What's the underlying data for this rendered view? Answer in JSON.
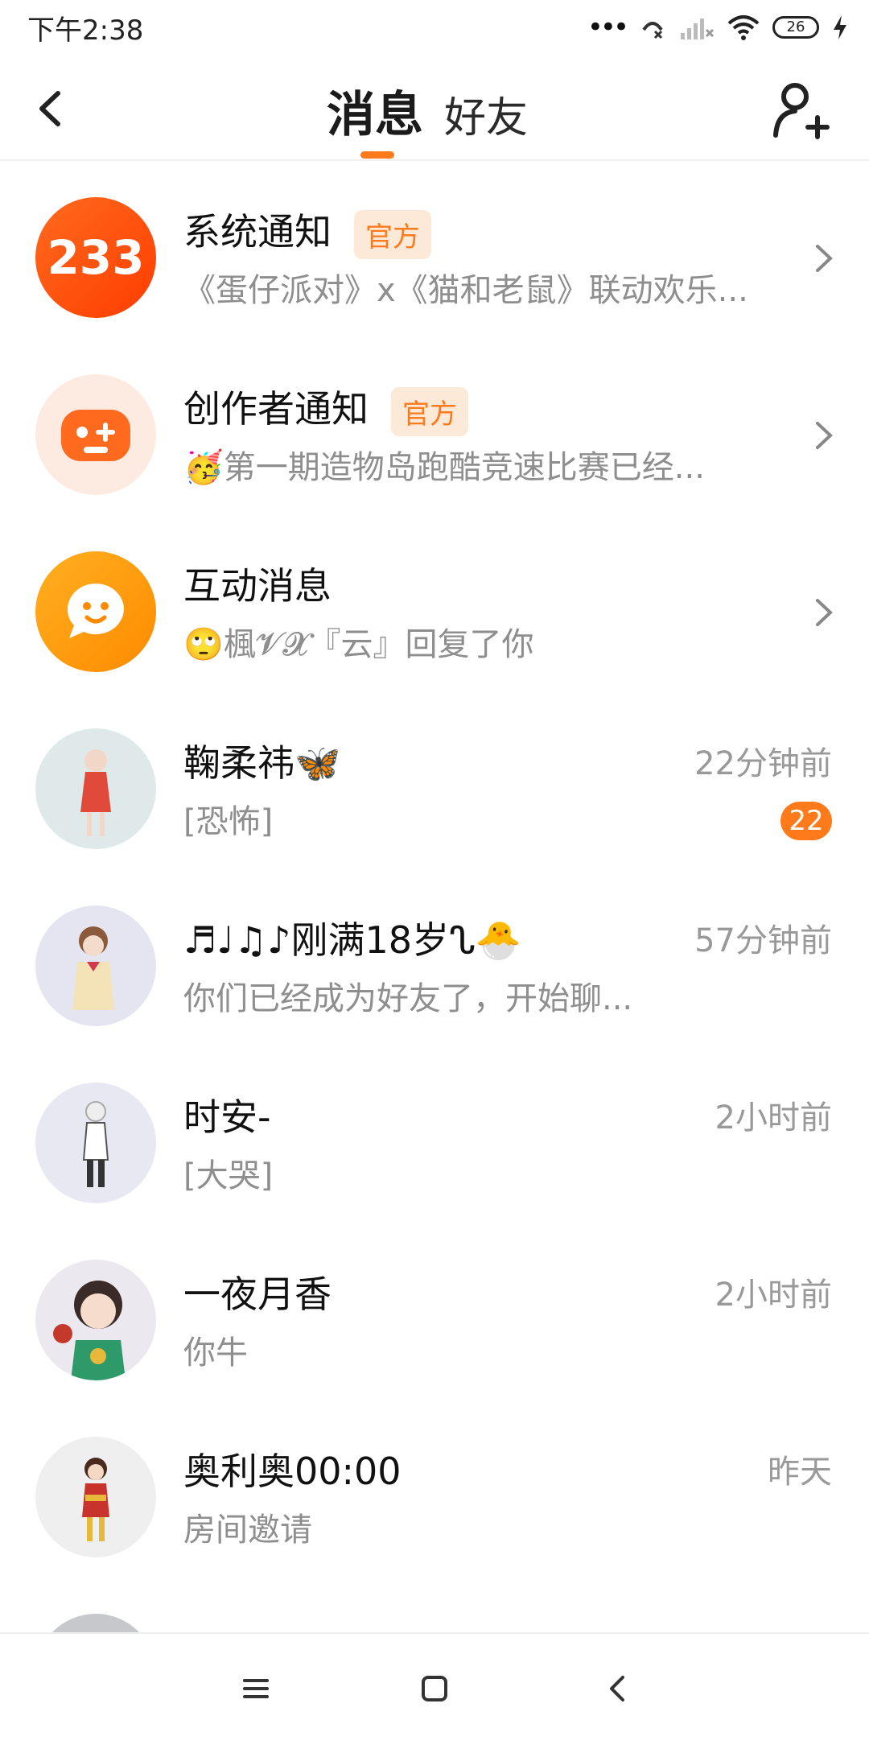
{
  "status_bar": {
    "time": "下午2:38",
    "battery": "26",
    "icons": [
      "more-dots-icon",
      "no-call-icon",
      "no-signal-icon",
      "wifi-icon",
      "battery-icon",
      "charging-icon"
    ]
  },
  "header": {
    "tab_messages": "消息",
    "tab_friends": "好友",
    "back_icon": "back-arrow-icon",
    "add_friend_icon": "add-user-icon",
    "accent_color": "#ff7a1a"
  },
  "rows": [
    {
      "name": "系统通知",
      "badge": "官方",
      "preview": "《蛋仔派对》x《猫和老鼠》联动欢乐...",
      "avatar_text": "233"
    },
    {
      "name": "创作者通知",
      "badge": "官方",
      "preview": "🥳第一期造物岛跑酷竞速比赛已经..."
    },
    {
      "name": "互动消息",
      "preview": "🙄楓𝓥𝓧『云』回复了你"
    },
    {
      "name": "鞠柔祎🦋",
      "preview": "[恐怖]",
      "time": "22分钟前",
      "unread": "22"
    },
    {
      "name": "♬♩♫♪刚满18岁ᔐ🐣",
      "preview": "你们已经成为好友了，开始聊...",
      "time": "57分钟前"
    },
    {
      "name": "时安-",
      "preview": "[大哭]",
      "time": "2小时前"
    },
    {
      "name": "一夜月香",
      "preview": "你牛",
      "time": "2小时前"
    },
    {
      "name": "奥利奥00:00",
      "preview": "房间邀请",
      "time": "昨天"
    }
  ],
  "nav": {
    "icons": [
      "menu-icon",
      "home-icon",
      "back-icon"
    ]
  }
}
